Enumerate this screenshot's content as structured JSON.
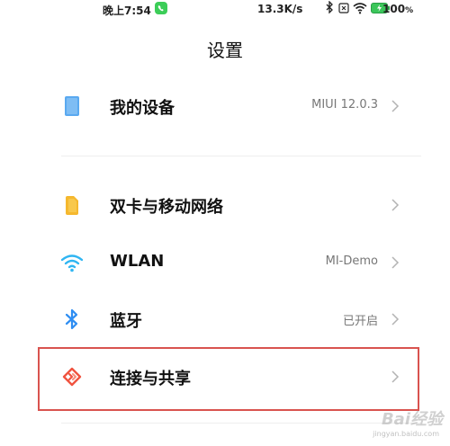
{
  "status_bar": {
    "time": "晚上7:54",
    "network_speed": "13.3K/s",
    "battery": "100",
    "battery_unit": "%",
    "icons": [
      "bluetooth-icon",
      "sim-icon",
      "wifi-icon",
      "battery-icon"
    ]
  },
  "page": {
    "title": "设置"
  },
  "items": [
    {
      "label": "我的设备",
      "value": "MIUI 12.0.3",
      "icon": "device-icon",
      "icon_color": "#5aa9f0"
    },
    {
      "label": "双卡与移动网络",
      "value": "",
      "icon": "sim-card-icon",
      "icon_color": "#f5b82e"
    },
    {
      "label": "WLAN",
      "value": "MI-Demo",
      "icon": "wifi-icon",
      "icon_color": "#2fb5f2"
    },
    {
      "label": "蓝牙",
      "value": "已开启",
      "icon": "bluetooth-icon",
      "icon_color": "#2f8ef2"
    },
    {
      "label": "连接与共享",
      "value": "",
      "icon": "connection-share-icon",
      "icon_color": "#f0533f"
    }
  ],
  "annotation": {
    "color": "#d9534f"
  },
  "watermark": {
    "text": "Bai经验",
    "url": "jingyan.baidu.com"
  }
}
